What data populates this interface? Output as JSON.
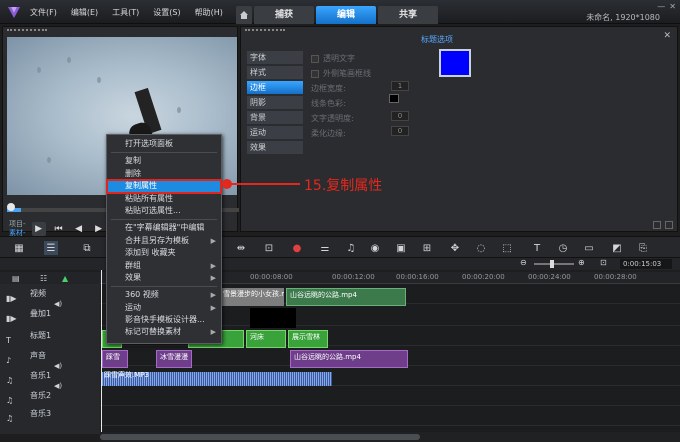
{
  "menu": [
    "文件(F)",
    "编辑(E)",
    "工具(T)",
    "设置(S)",
    "帮助(H)"
  ],
  "tabs": [
    {
      "label": "捕获",
      "active": false
    },
    {
      "label": "编辑",
      "active": true
    },
    {
      "label": "共享",
      "active": false
    }
  ],
  "window": {
    "title": "未命名, 1920*1080",
    "min": "—",
    "close": "✕"
  },
  "preview": {
    "project_label": "项目-",
    "clip_label": "素材-",
    "edge_label": "23"
  },
  "options": {
    "title": "标题选项",
    "close": "✕",
    "tabs": [
      {
        "label": "字体",
        "active": false
      },
      {
        "label": "样式",
        "active": false
      },
      {
        "label": "边框",
        "active": true
      },
      {
        "label": "阴影",
        "active": false
      },
      {
        "label": "背景",
        "active": false
      },
      {
        "label": "运动",
        "active": false
      },
      {
        "label": "效果",
        "active": false
      }
    ],
    "rows": [
      {
        "label": "透明文字",
        "type": "check"
      },
      {
        "label": "外侧笔画框线",
        "type": "check"
      },
      {
        "label": "边框宽度:",
        "type": "spin",
        "value": "1"
      },
      {
        "label": "线条色彩:",
        "type": "color"
      },
      {
        "label": "文字透明度:",
        "type": "spin",
        "value": "0"
      },
      {
        "label": "柔化边缘:",
        "type": "spin",
        "value": "0"
      }
    ],
    "colors": {
      "swatch": "#0000ff",
      "line_color": "#000000"
    }
  },
  "timecode": "0:00:15:03",
  "ruler": [
    "00:00:08:00",
    "00:00:12:00",
    "00:00:16:00",
    "00:00:20:00",
    "00:00:24:00",
    "00:00:28:00"
  ],
  "tracks": [
    {
      "name": "视频",
      "icon": "video-track-icon"
    },
    {
      "name": "叠加1",
      "icon": "overlay-track-icon"
    },
    {
      "name": "标题1",
      "icon": "title-track-icon"
    },
    {
      "name": "声音",
      "icon": "voice-track-icon"
    },
    {
      "name": "音乐1",
      "icon": "music-track-icon"
    },
    {
      "name": "音乐2",
      "icon": "music-track-icon"
    },
    {
      "name": "音乐3",
      "icon": "music-track-icon"
    }
  ],
  "clips": {
    "video1": "雪景漫步的小女孩.mp4",
    "video2": "山谷远眺的公路.mp4",
    "title1": "山谷",
    "title2": "河床",
    "title3": "展示雪林",
    "voice1": "踩雪",
    "voice2": "冰雪漫漫",
    "voice3": "山谷远眺的公路.mp4",
    "music1": "踩雪声效.MP3"
  },
  "context_menu": [
    {
      "label": "打开选项面板"
    },
    {
      "sep": true
    },
    {
      "label": "复制"
    },
    {
      "label": "删除"
    },
    {
      "label": "复制属性",
      "highlight": true
    },
    {
      "label": "粘贴所有属性"
    },
    {
      "label": "粘贴可选属性..."
    },
    {
      "sep": true
    },
    {
      "label": "在\"字幕编辑器\"中编辑"
    },
    {
      "label": "合并且另存为模板",
      "sub": true
    },
    {
      "label": "添加到 收藏夹"
    },
    {
      "label": "群组",
      "sub": true
    },
    {
      "label": "效果",
      "sub": true
    },
    {
      "sep": true
    },
    {
      "label": "360 视频",
      "sub": true
    },
    {
      "label": "运动",
      "sub": true
    },
    {
      "label": "影音快手模板设计器..."
    },
    {
      "label": "标记可替换素材",
      "sub": true
    }
  ],
  "annotation": "15.复制属性"
}
